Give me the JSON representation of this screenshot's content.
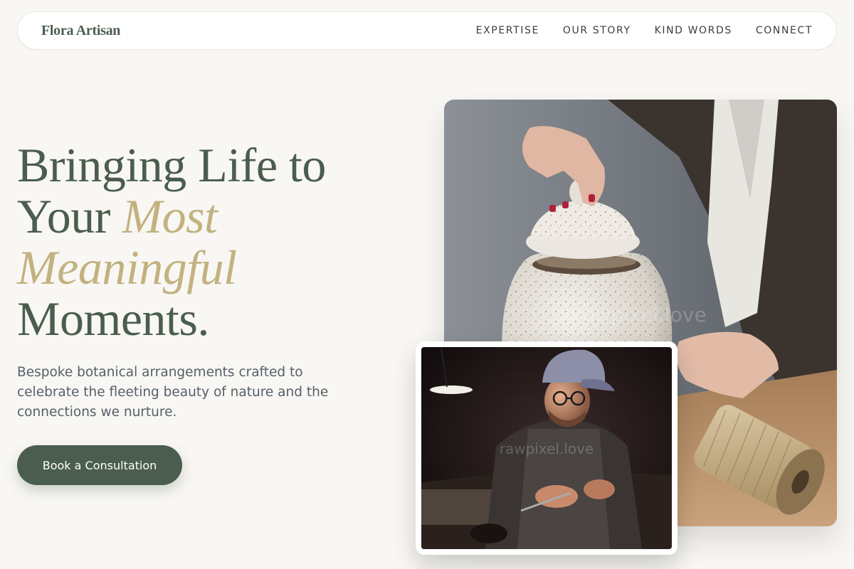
{
  "brand": "Flora Artisan",
  "nav": {
    "links": [
      "EXPERTISE",
      "OUR STORY",
      "KIND WORDS",
      "CONNECT"
    ]
  },
  "hero": {
    "title_part1": "Bringing Life to Your ",
    "title_accent": "Most Meaningful",
    "title_part2": "Moments.",
    "subtitle": "Bespoke botanical arrangements crafted to celebrate the fleeting beauty of nature and the connections we nurture.",
    "cta_label": "Book a Consultation"
  },
  "images": {
    "main_alt": "Hands lifting the lid of a speckled ceramic jar beside a spool of twine",
    "small_alt": "Craftsman in a cap working with small tools in a dim workshop",
    "watermark": "rawpixel.love"
  },
  "colors": {
    "background": "#f9f7f3",
    "primary": "#4a5d4e",
    "accent": "#c2b280",
    "body_text": "#55606a"
  }
}
